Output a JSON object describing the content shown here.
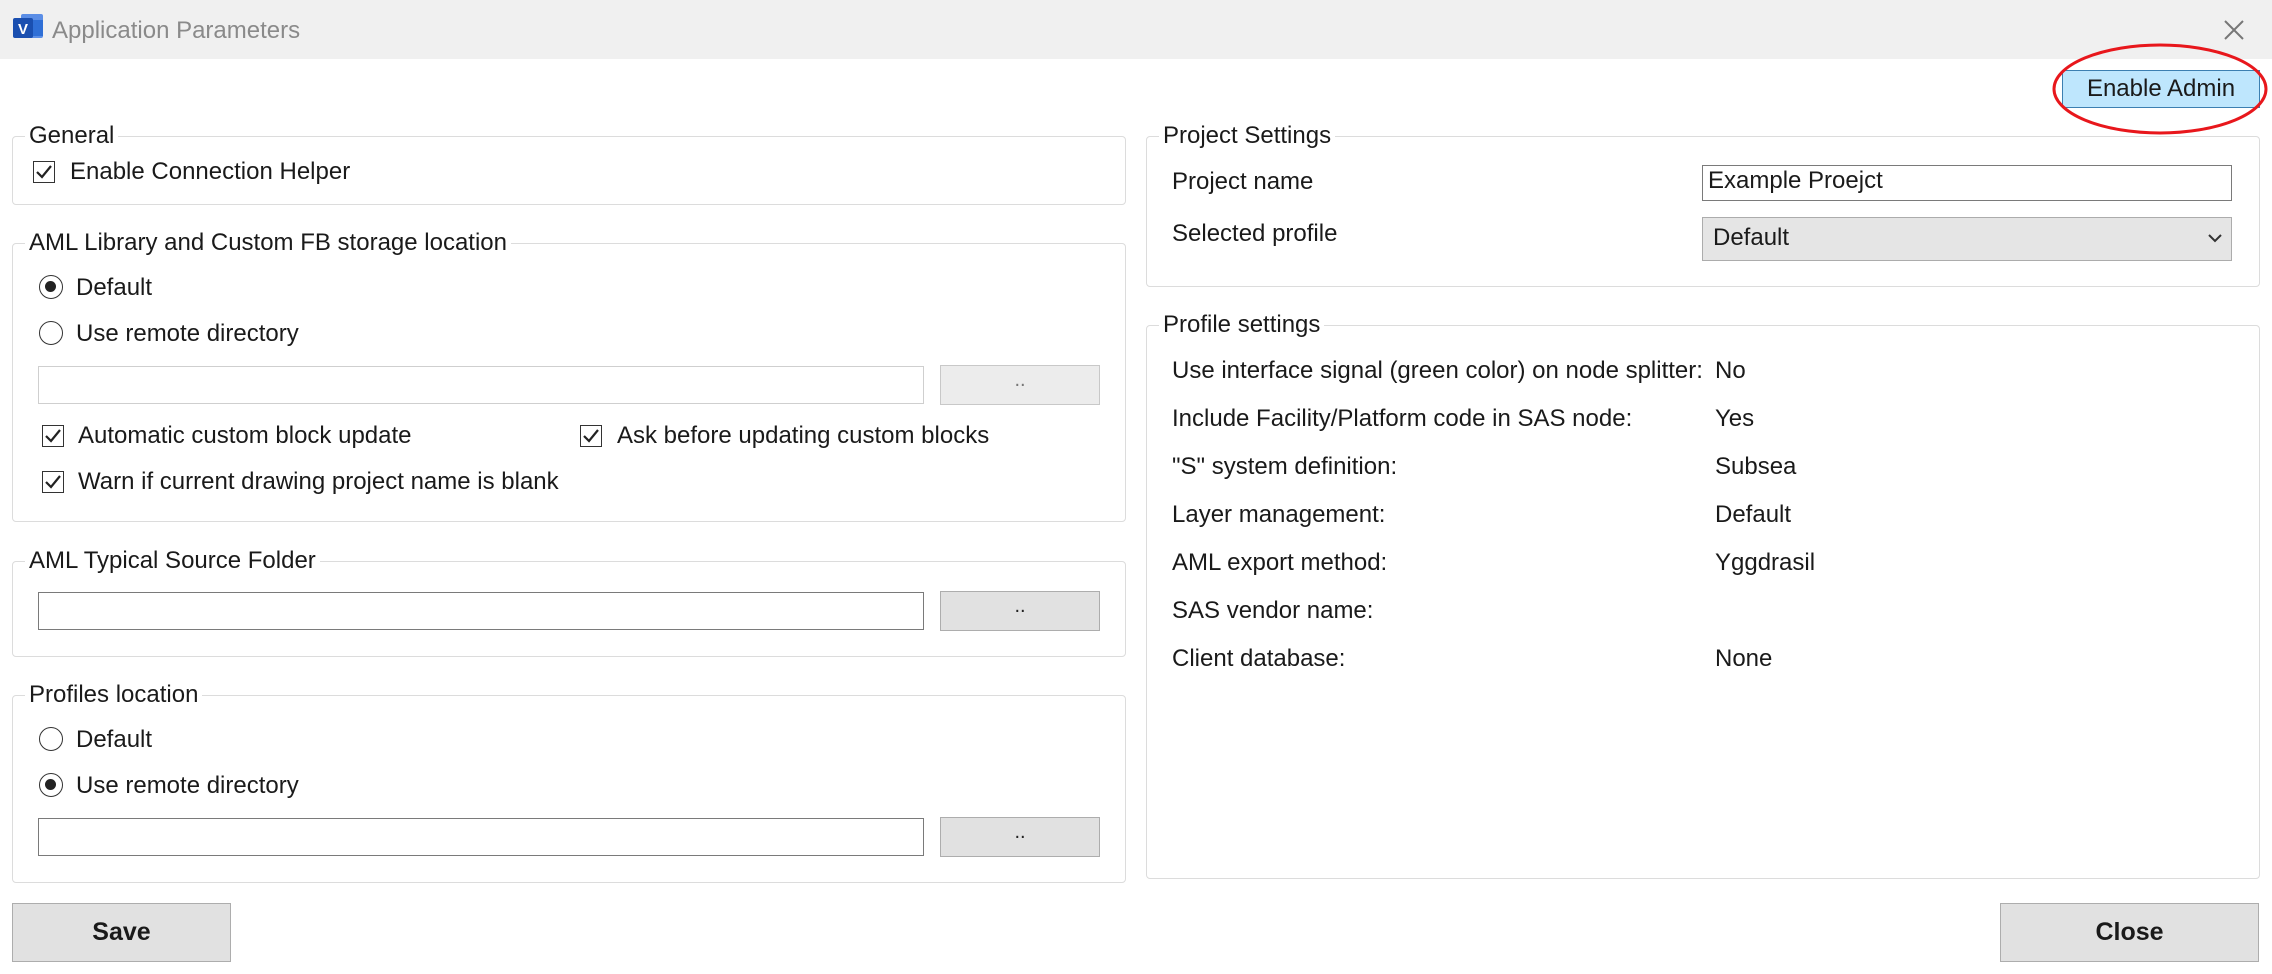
{
  "window": {
    "title": "Application Parameters",
    "app_icon": "visio-icon",
    "close_icon": "close-icon"
  },
  "admin": {
    "button_label": "Enable Admin",
    "highlight_color": "#e8171c"
  },
  "general": {
    "legend": "General",
    "enable_connection_helper": {
      "label": "Enable Connection Helper",
      "checked": true
    }
  },
  "aml_library": {
    "legend": "AML Library and Custom FB storage location",
    "radio_default": {
      "label": "Default",
      "selected": true
    },
    "radio_remote": {
      "label": "Use remote directory",
      "selected": false
    },
    "path_value": "",
    "browse_label": "..",
    "auto_update": {
      "label": "Automatic custom block update",
      "checked": true
    },
    "ask_before": {
      "label": "Ask before updating custom blocks",
      "checked": true
    },
    "warn_blank": {
      "label": "Warn if current drawing project name is blank",
      "checked": true
    }
  },
  "aml_typical": {
    "legend": "AML Typical Source Folder",
    "path_value": "",
    "browse_label": ".."
  },
  "profiles_location": {
    "legend": "Profiles location",
    "radio_default": {
      "label": "Default",
      "selected": false
    },
    "radio_remote": {
      "label": "Use remote directory",
      "selected": true
    },
    "path_value": "",
    "browse_label": ".."
  },
  "project_settings": {
    "legend": "Project Settings",
    "project_name_label": "Project name",
    "project_name_value": "Example Proejct",
    "selected_profile_label": "Selected profile",
    "selected_profile_value": "Default"
  },
  "profile_settings": {
    "legend": "Profile settings",
    "rows": [
      {
        "label": "Use interface signal (green color) on node splitter:",
        "value": "No"
      },
      {
        "label": "Include Facility/Platform code in SAS node:",
        "value": "Yes"
      },
      {
        "label": "\"S\" system definition:",
        "value": "Subsea"
      },
      {
        "label": "Layer management:",
        "value": "Default"
      },
      {
        "label": "AML export method:",
        "value": "Yggdrasil"
      },
      {
        "label": "SAS vendor name:",
        "value": ""
      },
      {
        "label": "Client database:",
        "value": "None"
      }
    ]
  },
  "footer": {
    "save_label": "Save",
    "close_label": "Close"
  }
}
